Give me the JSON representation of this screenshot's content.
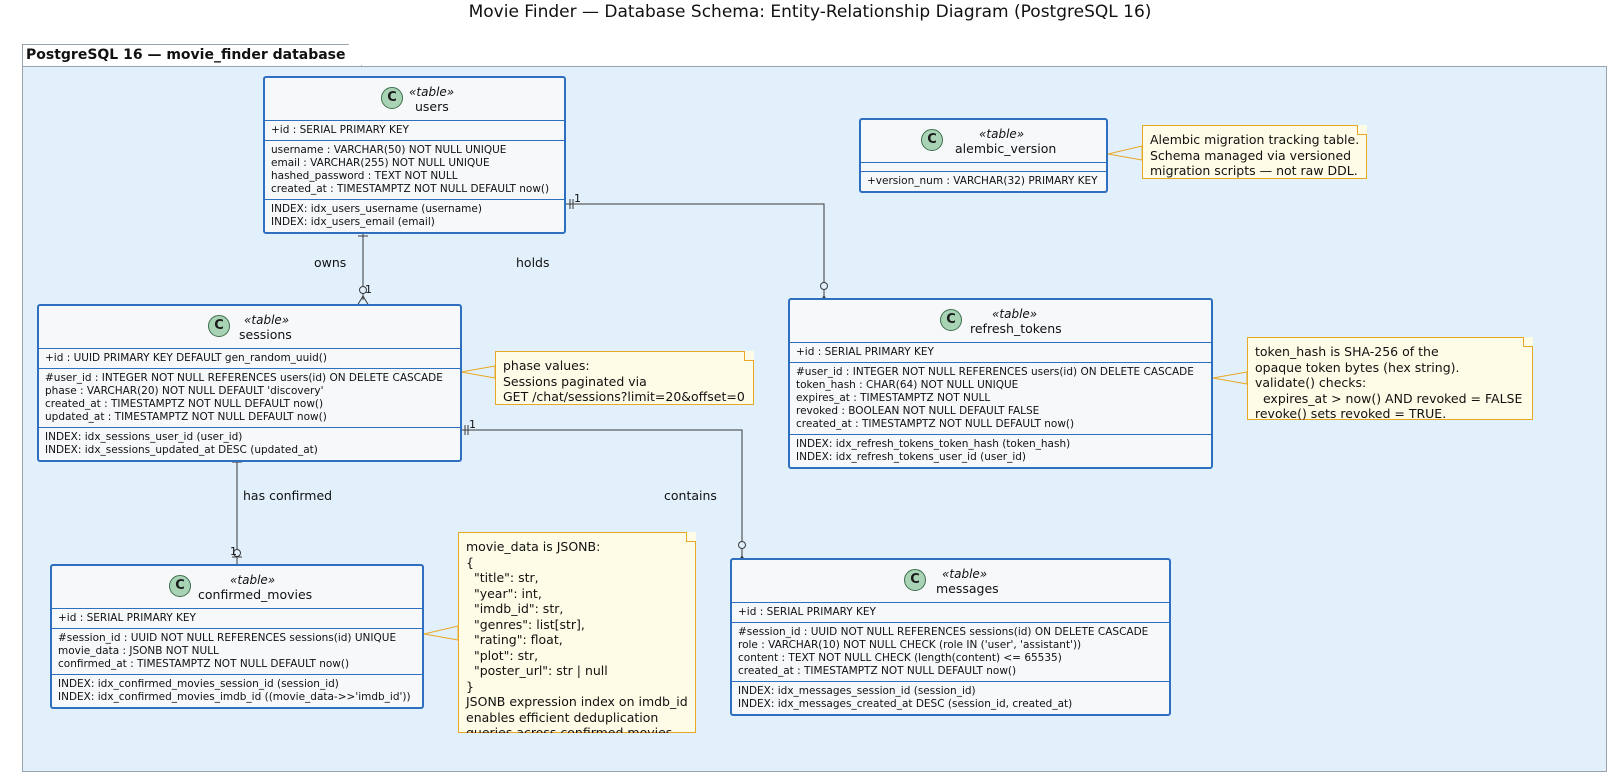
{
  "title": "Movie Finder — Database Schema: Entity-Relationship Diagram (PostgreSQL 16)",
  "package": "PostgreSQL 16 — movie_finder database",
  "stereotype": "«table»",
  "entities": {
    "users": {
      "name": "users",
      "pk": [
        "+id : SERIAL PRIMARY KEY"
      ],
      "columns": [
        "username : VARCHAR(50) NOT NULL UNIQUE",
        "email : VARCHAR(255) NOT NULL UNIQUE",
        "hashed_password : TEXT NOT NULL",
        "created_at : TIMESTAMPTZ NOT NULL DEFAULT now()"
      ],
      "indexes": [
        "INDEX: idx_users_username (username)",
        "INDEX: idx_users_email (email)"
      ]
    },
    "alembic_version": {
      "name": "alembic_version",
      "columns": [
        "+version_num : VARCHAR(32) PRIMARY KEY"
      ]
    },
    "sessions": {
      "name": "sessions",
      "pk": [
        "+id : UUID PRIMARY KEY DEFAULT gen_random_uuid()"
      ],
      "columns": [
        "#user_id : INTEGER NOT NULL REFERENCES users(id) ON DELETE CASCADE",
        "phase : VARCHAR(20) NOT NULL DEFAULT 'discovery'",
        "created_at : TIMESTAMPTZ NOT NULL DEFAULT now()",
        "updated_at : TIMESTAMPTZ NOT NULL DEFAULT now()"
      ],
      "indexes": [
        "INDEX: idx_sessions_user_id (user_id)",
        "INDEX: idx_sessions_updated_at DESC (updated_at)"
      ]
    },
    "refresh_tokens": {
      "name": "refresh_tokens",
      "pk": [
        "+id : SERIAL PRIMARY KEY"
      ],
      "columns": [
        "#user_id : INTEGER NOT NULL REFERENCES users(id) ON DELETE CASCADE",
        "token_hash : CHAR(64) NOT NULL UNIQUE",
        "expires_at : TIMESTAMPTZ NOT NULL",
        "revoked : BOOLEAN NOT NULL DEFAULT FALSE",
        "created_at : TIMESTAMPTZ NOT NULL DEFAULT now()"
      ],
      "indexes": [
        "INDEX: idx_refresh_tokens_token_hash (token_hash)",
        "INDEX: idx_refresh_tokens_user_id (user_id)"
      ]
    },
    "confirmed_movies": {
      "name": "confirmed_movies",
      "pk": [
        "+id : SERIAL PRIMARY KEY"
      ],
      "columns": [
        "#session_id : UUID NOT NULL REFERENCES sessions(id) UNIQUE",
        "movie_data : JSONB NOT NULL",
        "confirmed_at : TIMESTAMPTZ NOT NULL DEFAULT now()"
      ],
      "indexes": [
        "INDEX: idx_confirmed_movies_session_id (session_id)",
        "INDEX: idx_confirmed_movies_imdb_id ((movie_data->>'imdb_id'))"
      ]
    },
    "messages": {
      "name": "messages",
      "pk": [
        "+id : SERIAL PRIMARY KEY"
      ],
      "columns": [
        "#session_id : UUID NOT NULL REFERENCES sessions(id) ON DELETE CASCADE",
        "role : VARCHAR(10) NOT NULL CHECK (role IN ('user', 'assistant'))",
        "content : TEXT NOT NULL CHECK (length(content) <= 65535)",
        "created_at : TIMESTAMPTZ NOT NULL DEFAULT now()"
      ],
      "indexes": [
        "INDEX: idx_messages_session_id (session_id)",
        "INDEX: idx_messages_created_at DESC (session_id, created_at)"
      ]
    }
  },
  "notes": {
    "alembic": [
      "Alembic migration tracking table.",
      "Schema managed via versioned",
      "migration scripts — not raw DDL."
    ],
    "sessions": [
      "phase values:",
      "Sessions paginated via",
      "GET /chat/sessions?limit=20&offset=0"
    ],
    "tokens": [
      "token_hash is SHA-256 of the",
      "opaque token bytes (hex string).",
      "validate() checks:",
      "  expires_at > now() AND revoked = FALSE",
      "revoke() sets revoked = TRUE."
    ],
    "movies": [
      "movie_data is JSONB:",
      "{",
      "  \"title\": str,",
      "  \"year\": int,",
      "  \"imdb_id\": str,",
      "  \"genres\": list[str],",
      "  \"rating\": float,",
      "  \"plot\": str,",
      "  \"poster_url\": str | null",
      "}",
      "JSONB expression index on imdb_id",
      "enables efficient deduplication",
      "queries across confirmed movies."
    ]
  },
  "relationships": {
    "owns": "owns",
    "holds": "holds",
    "has_confirmed": "has confirmed",
    "contains": "contains"
  },
  "cardinality": {
    "one": "1"
  }
}
